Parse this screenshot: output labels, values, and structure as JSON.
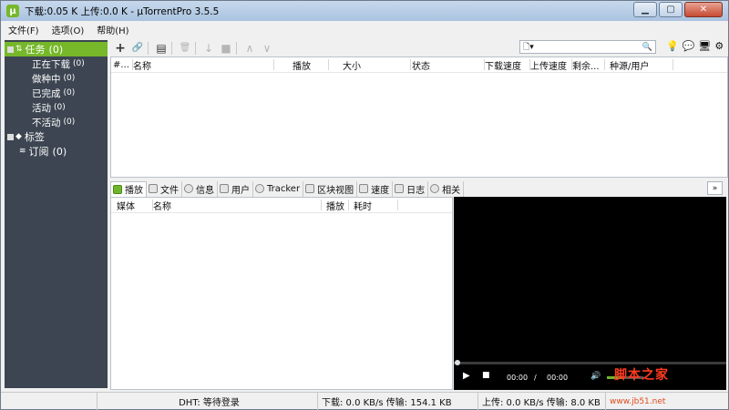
{
  "window": {
    "title": "下载:0.05 K 上传:0.0 K - µTorrentPro 3.5.5",
    "app_icon_glyph": "µ",
    "minimize": "▁",
    "maximize": "▢",
    "close": "✕"
  },
  "menu": {
    "file": "文件(F)",
    "options": "选项(O)",
    "help": "帮助(H)"
  },
  "sidebar": {
    "torrents": {
      "label": "任务",
      "count": "(0)"
    },
    "sub": [
      {
        "label": "正在下载",
        "count": "(0)"
      },
      {
        "label": "做种中",
        "count": "(0)"
      },
      {
        "label": "已完成",
        "count": "(0)"
      },
      {
        "label": "活动",
        "count": "(0)"
      },
      {
        "label": "不活动",
        "count": "(0)"
      }
    ],
    "labels": {
      "label": "标签"
    },
    "feeds": {
      "label": "订阅",
      "count": "(0)"
    }
  },
  "toolbar": {
    "add_icon": "+",
    "link_icon": "🔗",
    "create_icon": "▤",
    "remove_icon": "🗑",
    "start_icon": "↓",
    "stop_icon": "■",
    "up_icon": "∧",
    "down_icon": "∨",
    "search_icon": "🔍",
    "search_doc_icon": "🗋▾",
    "right_icons": [
      "💡",
      "💬",
      "🖥",
      "⚙"
    ]
  },
  "torrent_table": {
    "columns": [
      "#...",
      "名称",
      "播放",
      "大小",
      "状态",
      "下载速度",
      "上传速度",
      "剩余...",
      "种源/用户"
    ]
  },
  "tabs": [
    {
      "label": "播放",
      "active": true
    },
    {
      "label": "文件"
    },
    {
      "label": "信息"
    },
    {
      "label": "用户"
    },
    {
      "label": "Tracker"
    },
    {
      "label": "区块视图"
    },
    {
      "label": "速度"
    },
    {
      "label": "日志"
    },
    {
      "label": "相关"
    }
  ],
  "collapse_label": "»",
  "media_table": {
    "columns": [
      "媒体",
      "名称",
      "播放",
      "耗时"
    ]
  },
  "player": {
    "play_icon": "▶",
    "stop_icon": "■",
    "time_current": "00:00",
    "time_sep": "/",
    "time_total": "00:00",
    "volume_icon": "🔊",
    "volume_level": 0.4,
    "watermark": "脚本之家",
    "watermark_url": "www.jb51.net"
  },
  "status": {
    "dht": "DHT: 等待登录",
    "download": "下载: 0.0 KB/s 传输: 154.1 KB",
    "upload": "上传: 0.0 KB/s 传输: 8.0 KB"
  },
  "colors": {
    "accent": "#76b82a",
    "sidebar_bg": "#3c4551"
  }
}
